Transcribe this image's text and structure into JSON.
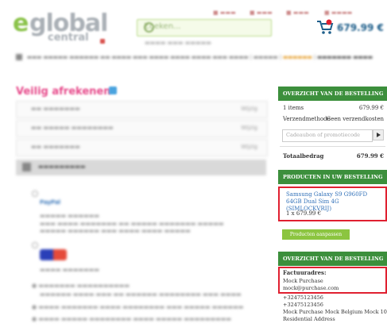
{
  "header": {
    "logo_e": "e",
    "logo_global": "global",
    "logo_central": "central",
    "search_placeholder": "Zoeken...",
    "cart_total": "679.99 €"
  },
  "checkout": {
    "title": "Veilig afrekenen",
    "wijzig": "Wijzig"
  },
  "summary": {
    "heading": "OVERZICHT VAN DE BESTELLING",
    "items_label": "1 items",
    "items_value": "679.99 €",
    "shipping_label": "Verzendmethode",
    "shipping_value": "Geen verzendkosten",
    "promo_placeholder": "Cadeaubon of promotiecode",
    "total_label": "Totaalbedrag",
    "total_value": "679.99 €"
  },
  "products": {
    "heading": "PRODUCTEN IN UW BESTELLING",
    "name": "Samsung Galaxy S9 G960FD 64GB Dual Sim 4G (SIMLOCKVRIJ)",
    "qty_price": "1 x  679.99 €",
    "button": "Producten aanpassen"
  },
  "billing": {
    "heading": "OVERZICHT VAN DE BESTELLING",
    "label": "Factuuradres:",
    "name": "Mock Purchase",
    "email": "mock@purchase.com",
    "phone1": "+32475123456",
    "phone2": "+32475123456",
    "address": "Mock Purchase Mock Belgium Mock 1000",
    "type": "Residential Address"
  },
  "colors": {
    "panel_green": "#3c8f3c",
    "highlight_red": "#e02030",
    "link_blue": "#3070b8",
    "button_green": "#8cc540",
    "title_pink": "#e74c8c"
  }
}
